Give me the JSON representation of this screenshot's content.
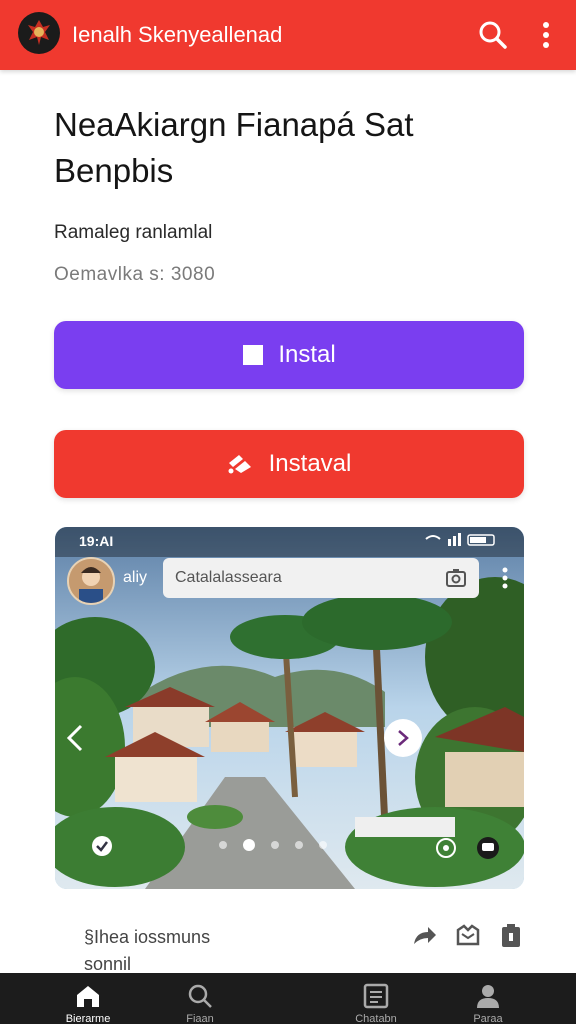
{
  "app": {
    "title": "Ienalh Skenyeallenad",
    "accent": "#f0392f"
  },
  "header": {
    "icons": [
      "search-icon",
      "more-vert-icon"
    ]
  },
  "listing": {
    "headline": "NeaAkiargn Fianapá Sat Benpbis",
    "subtitle": "Ramaleg ranlamlal",
    "meta": "Oemavlka  s: 3080"
  },
  "buttons": {
    "primary": {
      "label": "Instal",
      "color": "#7a3ef0",
      "icon": "square-icon"
    },
    "secondary": {
      "label": "Instaval",
      "color": "#f0392f",
      "icon": "cast-icon"
    }
  },
  "preview": {
    "status_time": "19:AI",
    "handle": "aliy",
    "search_value": "Catalalasseara",
    "carousel": {
      "dots": 5,
      "active": 1
    }
  },
  "caption": {
    "line1": "§Ihea iossmuns",
    "line2": "sonnil"
  },
  "actions": [
    "share-icon",
    "gift-icon",
    "bookmark-icon"
  ],
  "bottom_nav": {
    "items": [
      {
        "label": "Bierarme",
        "icon": "home-icon",
        "active": true
      },
      {
        "label": "Fiaan",
        "icon": "search-icon",
        "active": false
      },
      {
        "label": "Chatabn",
        "icon": "list-icon",
        "active": false
      },
      {
        "label": "Paraa",
        "icon": "profile-icon",
        "active": false
      }
    ]
  }
}
